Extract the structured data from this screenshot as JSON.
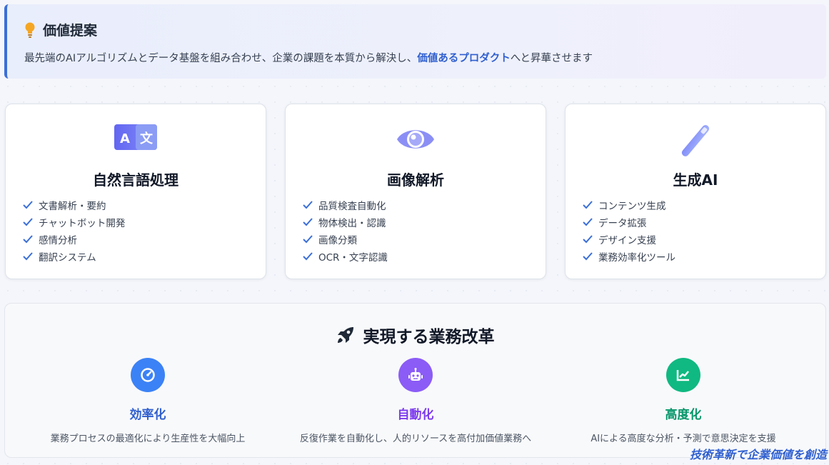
{
  "value": {
    "title": "価値提案",
    "text_before": "最先端のAIアルゴリズムとデータ基盤を組み合わせ、企業の課題を本質から解決し、",
    "highlight": "価値あるプロダクト",
    "text_after": "へと昇華させます",
    "icon": "lightbulb-icon"
  },
  "cards": [
    {
      "icon": "language-translate-icon",
      "title": "自然言語処理",
      "items": [
        "文書解析・要約",
        "チャットボット開発",
        "感情分析",
        "翻訳システム"
      ]
    },
    {
      "icon": "eye-icon",
      "title": "画像解析",
      "items": [
        "品質検査自動化",
        "物体検出・認識",
        "画像分類",
        "OCR・文字認識"
      ]
    },
    {
      "icon": "magic-wand-icon",
      "title": "生成AI",
      "items": [
        "コンテンツ生成",
        "データ拡張",
        "デザイン支援",
        "業務効率化ツール"
      ]
    }
  ],
  "impact": {
    "title": "実現する業務改革",
    "icon": "rocket-icon",
    "benefits": [
      {
        "icon": "gauge-icon",
        "title": "効率化",
        "desc": "業務プロセスの最適化により生産性を大幅向上",
        "color": "#3b82f6"
      },
      {
        "icon": "robot-icon",
        "title": "自動化",
        "desc": "反復作業を自動化し、人的リソースを高付加価値業務へ",
        "color": "#8b5cf6"
      },
      {
        "icon": "chart-line-icon",
        "title": "高度化",
        "desc": "AIによる高度な分析・予測で意思決定を支援",
        "color": "#10b981"
      }
    ]
  },
  "footer": {
    "tagline": "技術革新で企業価値を創造"
  },
  "colors": {
    "accent": "#2f5fcf",
    "check": "#3b6fd8",
    "icon_gradient_start": "#818cf8",
    "icon_gradient_end": "#a5b4fc"
  }
}
